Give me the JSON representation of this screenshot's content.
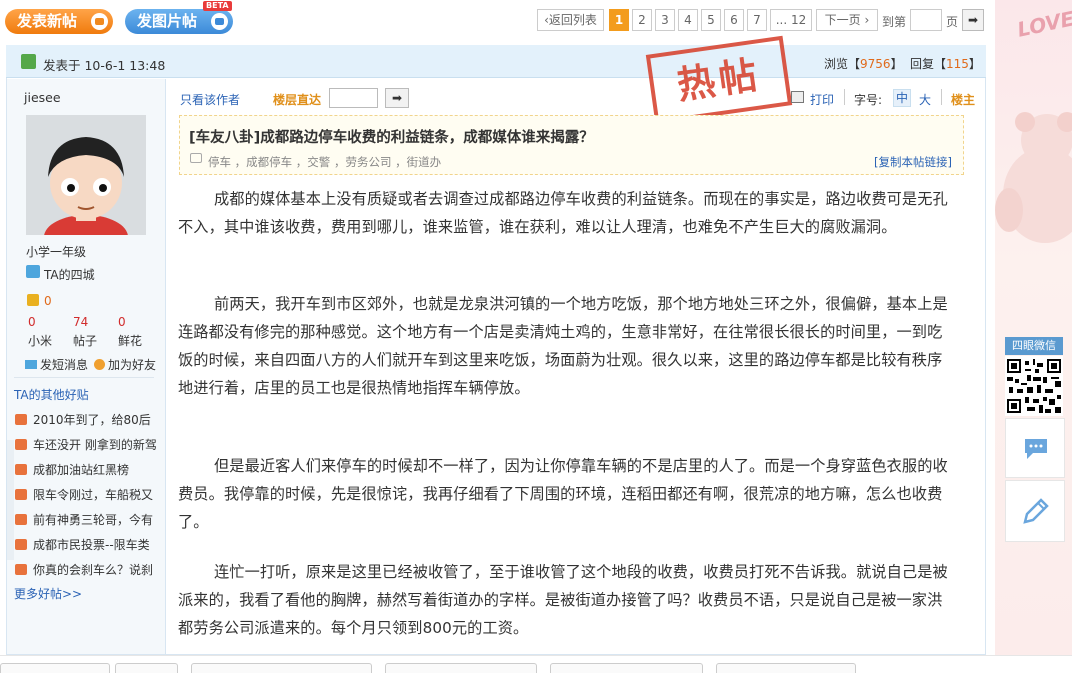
{
  "toolbar": {
    "post_label": "发表新帖",
    "pic_label": "发图片帖",
    "beta": "BETA"
  },
  "pager": {
    "back_label": "返回列表",
    "pages": [
      "1",
      "2",
      "3",
      "4",
      "5",
      "6",
      "7"
    ],
    "ellipsis_last": "... 12",
    "next_label": "下一页",
    "goto_label": "到第",
    "page_unit": "页",
    "go_arrow": "➡"
  },
  "post_header": {
    "posted": "发表于 10-6-1 13:48",
    "views_label": "浏览【",
    "views": "9756",
    "views_end": "】",
    "replies_label": "回复【",
    "replies": "115",
    "replies_end": "】"
  },
  "stamp": "热帖",
  "author": {
    "name": "jiesee",
    "level": "小学一年级",
    "city_link": "TA的四城",
    "coins": "0",
    "stats": [
      {
        "value": "0",
        "label": "小米"
      },
      {
        "value": "74",
        "label": "帖子"
      },
      {
        "value": "0",
        "label": "鲜花"
      }
    ],
    "pm_label": "发短消息",
    "friend_label": "加为好友"
  },
  "other_posts": {
    "title": "TA的其他好贴",
    "items": [
      "2010年到了，给80后",
      "车还没开 刚拿到的新驾",
      "成都加油站红黑榜",
      "限车令刚过，车船税又",
      "前有神勇三轮哥，今有",
      "成都市民投票--限车类",
      "你真的会刹车么？说刹"
    ],
    "more": "更多好帖>>"
  },
  "post_tools": {
    "only_author": "只看该作者",
    "floor_jump": "楼层直达",
    "print": "打印",
    "font_label": "字号:",
    "font_mid": "中",
    "font_big": "大",
    "floor": "楼主"
  },
  "post": {
    "title": "[车友八卦]成都路边停车收费的利益链条，成都媒体谁来揭露？",
    "tags": "停车 ，成都停车 ，交警 ，劳务公司 ，街道办",
    "copy_link": "[复制本帖链接]",
    "paragraphs": [
      "成都的媒体基本上没有质疑或者去调查过成都路边停车收费的利益链条。而现在的事实是，路边收费可是无孔不入，其中谁该收费，费用到哪儿，谁来监管，谁在获利，难以让人理清，也难免不产生巨大的腐败漏洞。",
      "前两天，我开车到市区郊外，也就是龙泉洪河镇的一个地方吃饭，那个地方地处三环之外，很偏僻，基本上是连路都没有修完的那种感觉。这个地方有一个店是卖清炖土鸡的，生意非常好，在往常很长很长的时间里，一到吃饭的时候，来自四面八方的人们就开车到这里来吃饭，场面蔚为壮观。很久以来，这里的路边停车都是比较有秩序地进行着，店里的员工也是很热情地指挥车辆停放。",
      "但是最近客人们来停车的时候却不一样了，因为让你停靠车辆的不是店里的人了。而是一个身穿蓝色衣服的收费员。我停靠的时候，先是很惊诧，我再仔细看了下周围的环境，连稻田都还有啊，很荒凉的地方嘛，怎么也收费了。",
      "连忙一打听，原来是这里已经被收管了，至于谁收管了这个地段的收费，收费员打死不告诉我。就说自己是被派来的，我看了看他的胸牌，赫然写着街道办的字样。是被街道办接管了吗？收费员不语，只是说自己是被一家洪都劳务公司派遣来的。每个月只领到800元的工资。"
    ]
  },
  "right_sidebar": {
    "wechat_label": "四眼微信",
    "love_text": "LOVE"
  },
  "colors": {
    "accent_orange": "#f39c1d",
    "link_blue": "#2b63b5",
    "header_bg": "#e3f1fb"
  }
}
